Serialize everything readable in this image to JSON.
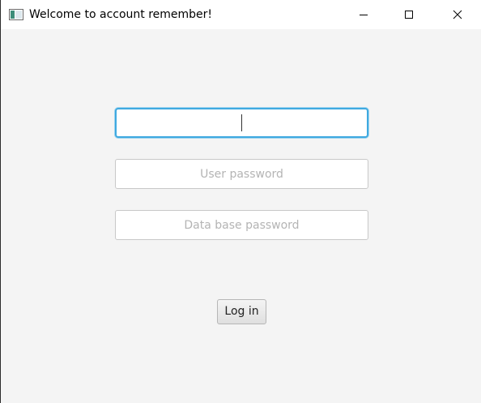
{
  "window": {
    "title": "Welcome to account remember!",
    "icon": "app-window-icon",
    "controls": {
      "minimize_icon": "minimize-icon",
      "maximize_icon": "maximize-icon",
      "close_icon": "close-icon"
    }
  },
  "form": {
    "username": {
      "value": "",
      "placeholder": "",
      "focused": true
    },
    "user_password": {
      "value": "",
      "placeholder": "User password"
    },
    "database_password": {
      "value": "",
      "placeholder": "Data base password"
    },
    "login_label": "Log in"
  },
  "colors": {
    "background": "#f4f4f4",
    "focus_ring": "#3fa9e0",
    "field_border": "#c8c8c8",
    "placeholder": "#b4b4b4"
  }
}
